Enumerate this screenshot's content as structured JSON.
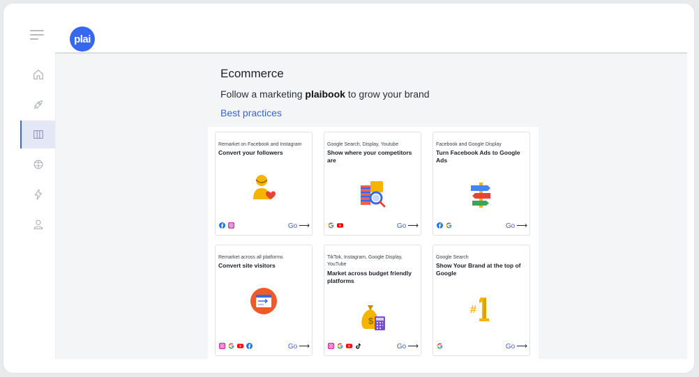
{
  "app": {
    "logo_text": "plai",
    "brand_color": "#3568ef"
  },
  "sidebar": {
    "items": [
      {
        "icon": "home-icon",
        "active": false
      },
      {
        "icon": "rocket-icon",
        "active": false
      },
      {
        "icon": "book-icon",
        "active": true
      },
      {
        "icon": "brain-icon",
        "active": false
      },
      {
        "icon": "lightning-icon",
        "active": false
      },
      {
        "icon": "user-icon",
        "active": false
      }
    ]
  },
  "main": {
    "title": "Ecommerce",
    "subtitle_prefix": "Follow a marketing ",
    "subtitle_bold": "plaibook",
    "subtitle_suffix": " to grow your brand",
    "link": "Best practices"
  },
  "cards": [
    {
      "category": "Remarket on Facebook and Instagram",
      "title": "Convert your followers",
      "illustration": "person-heart-illustration",
      "platforms": [
        "facebook",
        "instagram"
      ],
      "go_label": "Go"
    },
    {
      "category": "Google Search, Display, Youtube",
      "title": "Show where your competitors are",
      "illustration": "competitor-search-illustration",
      "platforms": [
        "google",
        "youtube"
      ],
      "go_label": "Go"
    },
    {
      "category": "Facebook and Google Display",
      "title": "Turn Facebook Ads to Google Ads",
      "illustration": "signpost-illustration",
      "platforms": [
        "facebook",
        "google"
      ],
      "go_label": "Go"
    },
    {
      "category": "Remarket across all platforms",
      "title": "Convert site visitors",
      "illustration": "browser-visitor-illustration",
      "platforms": [
        "instagram",
        "google",
        "youtube",
        "facebook"
      ],
      "go_label": "Go"
    },
    {
      "category": "TikTok, Instagram, Google Display, YouTube",
      "title": "Market across budget friendly platforms",
      "illustration": "money-bag-illustration",
      "platforms": [
        "instagram",
        "google",
        "youtube",
        "tiktok"
      ],
      "go_label": "Go"
    },
    {
      "category": "Google Search",
      "title": "Show Your Brand at the top of Google",
      "illustration": "rank-number-one-illustration",
      "platforms": [
        "google"
      ],
      "go_label": "Go"
    }
  ],
  "colors": {
    "facebook": "#1877f2",
    "instagram": "#d6249f",
    "youtube": "#ff0000",
    "google_blue": "#4285f4",
    "google_red": "#ea4335",
    "google_yellow": "#fbbc05",
    "google_green": "#34a853",
    "link": "#3466d9"
  }
}
